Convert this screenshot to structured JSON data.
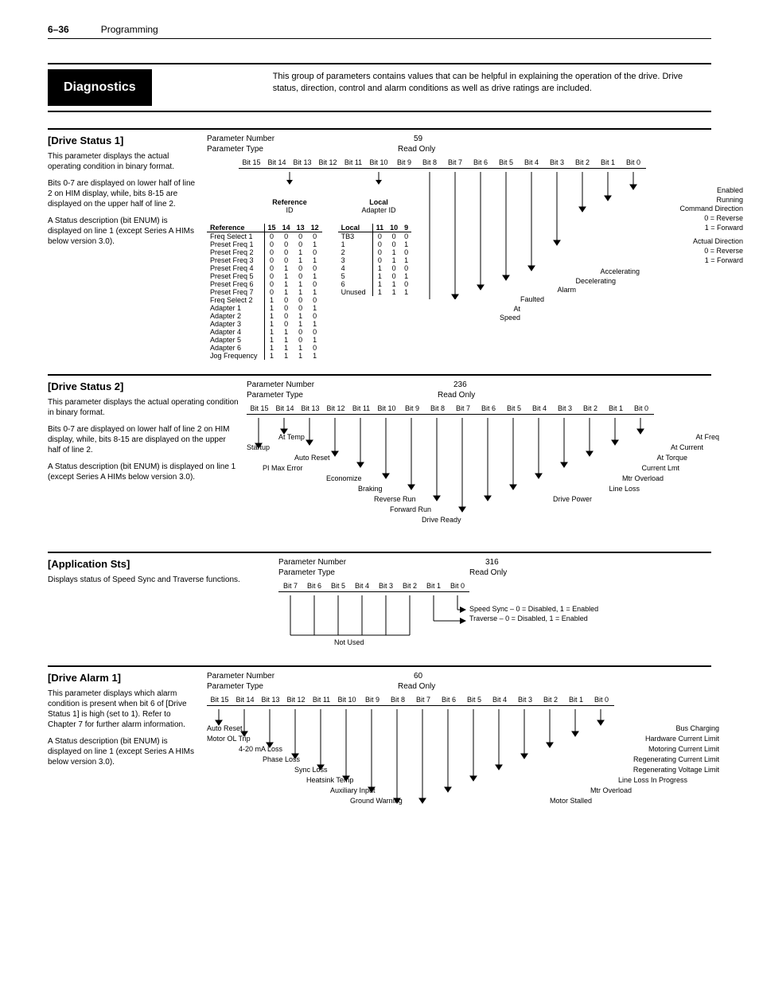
{
  "header": {
    "page": "6–36",
    "title": "Programming"
  },
  "diag": {
    "label": "Diagnostics",
    "desc": "This group of parameters contains values that can be helpful in explaining the operation of the drive. Drive status, direction, control and alarm conditions as well as drive ratings are included."
  },
  "bits16": [
    "Bit 15",
    "Bit 14",
    "Bit 13",
    "Bit 12",
    "Bit 11",
    "Bit 10",
    "Bit 9",
    "Bit 8",
    "Bit 7",
    "Bit 6",
    "Bit 5",
    "Bit 4",
    "Bit 3",
    "Bit 2",
    "Bit 1",
    "Bit 0"
  ],
  "bits8": [
    "Bit 7",
    "Bit 6",
    "Bit 5",
    "Bit 4",
    "Bit 3",
    "Bit 2",
    "Bit 1",
    "Bit 0"
  ],
  "ds1": {
    "title": "[Drive Status 1]",
    "d1": "This parameter displays the actual operating condition in binary format.",
    "d2": "Bits 0-7 are displayed on lower half of line 2 on HIM display, while, bits 8-15 are displayed on the upper half of line 2.",
    "d3": "A Status description (bit ENUM) is displayed on line 1 (except Series A HIMs below version 3.0).",
    "pn_lbl": "Parameter Number",
    "pn": "59",
    "pt_lbl": "Parameter Type",
    "pt": "Read Only",
    "ref_label": "Reference",
    "ref_sub": "ID",
    "loc_label": "Local",
    "loc_sub": "Adapter ID",
    "ref_head": [
      "15",
      "14",
      "13",
      "12"
    ],
    "ref_rows": [
      {
        "n": "Reference",
        "h": true
      },
      {
        "n": "Freq Select 1",
        "v": [
          "0",
          "0",
          "0",
          "0"
        ]
      },
      {
        "n": "Preset Freq 1",
        "v": [
          "0",
          "0",
          "0",
          "1"
        ]
      },
      {
        "n": "Preset Freq 2",
        "v": [
          "0",
          "0",
          "1",
          "0"
        ]
      },
      {
        "n": "Preset Freq 3",
        "v": [
          "0",
          "0",
          "1",
          "1"
        ]
      },
      {
        "n": "Preset Freq 4",
        "v": [
          "0",
          "1",
          "0",
          "0"
        ]
      },
      {
        "n": "Preset Freq 5",
        "v": [
          "0",
          "1",
          "0",
          "1"
        ]
      },
      {
        "n": "Preset Freq 6",
        "v": [
          "0",
          "1",
          "1",
          "0"
        ]
      },
      {
        "n": "Preset Freq 7",
        "v": [
          "0",
          "1",
          "1",
          "1"
        ]
      },
      {
        "n": "Freq Select 2",
        "v": [
          "1",
          "0",
          "0",
          "0"
        ]
      },
      {
        "n": "Adapter 1",
        "v": [
          "1",
          "0",
          "0",
          "1"
        ]
      },
      {
        "n": "Adapter 2",
        "v": [
          "1",
          "0",
          "1",
          "0"
        ]
      },
      {
        "n": "Adapter 3",
        "v": [
          "1",
          "0",
          "1",
          "1"
        ]
      },
      {
        "n": "Adapter 4",
        "v": [
          "1",
          "1",
          "0",
          "0"
        ]
      },
      {
        "n": "Adapter 5",
        "v": [
          "1",
          "1",
          "0",
          "1"
        ]
      },
      {
        "n": "Adapter 6",
        "v": [
          "1",
          "1",
          "1",
          "0"
        ]
      },
      {
        "n": "Jog Frequency",
        "v": [
          "1",
          "1",
          "1",
          "1"
        ]
      }
    ],
    "loc_head": [
      "11",
      "10",
      "9"
    ],
    "loc_rows": [
      {
        "n": "Local",
        "h": true
      },
      {
        "n": "TB3",
        "v": [
          "0",
          "0",
          "0"
        ]
      },
      {
        "n": "1",
        "v": [
          "0",
          "0",
          "1"
        ]
      },
      {
        "n": "2",
        "v": [
          "0",
          "1",
          "0"
        ]
      },
      {
        "n": "3",
        "v": [
          "0",
          "1",
          "1"
        ]
      },
      {
        "n": "4",
        "v": [
          "1",
          "0",
          "0"
        ]
      },
      {
        "n": "5",
        "v": [
          "1",
          "0",
          "1"
        ]
      },
      {
        "n": "6",
        "v": [
          "1",
          "1",
          "0"
        ]
      },
      {
        "n": "Unused",
        "v": [
          "1",
          "1",
          "1"
        ]
      }
    ],
    "rlabels": {
      "enabled": "Enabled",
      "running": "Running",
      "cmddir": "Command Direction",
      "rev0": "0 = Reverse",
      "fwd1": "1 = Forward",
      "actdir": "Actual Direction",
      "accel": "Accelerating",
      "decel": "Decelerating",
      "alarm": "Alarm",
      "faulted": "Faulted",
      "atspeed": "At Speed"
    }
  },
  "ds2": {
    "title": "[Drive Status 2]",
    "d1": "This parameter displays the actual operating condition in binary format.",
    "d2": "Bits 0-7 are displayed on lower half of line 2 on HIM display, while, bits 8-15 are displayed on the upper half of line 2.",
    "d3": "A Status description (bit ENUM) is displayed on line 1 (except Series A HIMs below version 3.0).",
    "pn_lbl": "Parameter Number",
    "pn": "236",
    "pt_lbl": "Parameter Type",
    "pt": "Read Only",
    "l": {
      "startup": "Startup",
      "attemp": "At Temp",
      "autoreset": "Auto Reset",
      "pimax": "PI Max Error",
      "econ": "Economize",
      "braking": "Braking",
      "revrun": "Reverse Run",
      "fwdrun": "Forward Run",
      "drvready": "Drive Ready",
      "drvpower": "Drive Power",
      "lineloss": "Line Loss",
      "mtrovl": "Mtr Overload",
      "curlmt": "Current Lmt",
      "attq": "At Torque",
      "atcur": "At Current",
      "atfreq": "At Freq"
    }
  },
  "app": {
    "title": "[Application Sts]",
    "d1": "Displays status of Speed Sync and Traverse functions.",
    "pn_lbl": "Parameter Number",
    "pn": "316",
    "pt_lbl": "Parameter Type",
    "pt": "Read Only",
    "ss": "Speed Sync – 0 = Disabled, 1 = Enabled",
    "tr": "Traverse – 0 = Disabled, 1 = Enabled",
    "nu": "Not Used"
  },
  "da1": {
    "title": "[Drive Alarm 1]",
    "d1": "This parameter displays which alarm condition is present when bit 6 of [Drive Status 1] is high (set to 1). Refer to Chapter 7 for further alarm information.",
    "d2": "A Status description (bit ENUM) is displayed on line 1 (except Series A HIMs below version 3.0).",
    "pn_lbl": "Parameter Number",
    "pn": "60",
    "pt_lbl": "Parameter Type",
    "pt": "Read Only",
    "l": {
      "autoreset": "Auto Reset",
      "motorol": "Motor OL Trip",
      "ma": "4-20 mA Loss",
      "phloss": "Phase Loss",
      "syncl": "Sync Loss",
      "hstemp": "Heatsink Temp",
      "auxin": "Auxiliary Input",
      "gndw": "Ground Warning",
      "mstall": "Motor Stalled",
      "mtrovl": "Mtr Overload",
      "llip": "Line Loss In Progress",
      "regvl": "Regenerating Voltage Limit",
      "regcl": "Regenerating Current Limit",
      "motcl": "Motoring Current Limit",
      "hwcl": "Hardware Current Limit",
      "busch": "Bus Charging"
    }
  }
}
